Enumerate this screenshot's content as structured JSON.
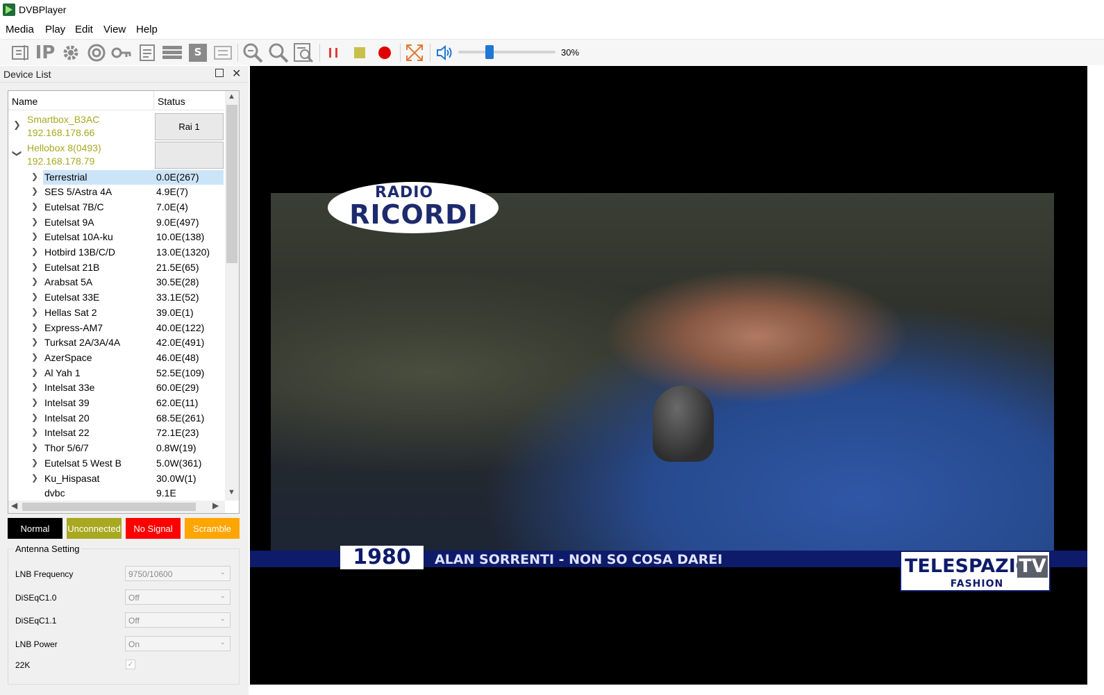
{
  "window": {
    "title": "DVBPlayer"
  },
  "menu": [
    "Media",
    "Play",
    "Edit",
    "View",
    "Help"
  ],
  "toolbar": {
    "icons": [
      "edit-icon",
      "ip-icon",
      "settings-gear-icon",
      "scan-icon",
      "key-icon",
      "notes-icon",
      "list-icon",
      "cam-icon",
      "led-icon",
      "zoom-in-icon",
      "search-icon",
      "report-icon",
      "pause-icon",
      "stop-icon",
      "record-icon",
      "fullscreen-icon",
      "volume-icon"
    ],
    "ip_label": "IP",
    "volume_percent": 30,
    "volume_label": "30%",
    "colors": {
      "pause": "#e23b3b",
      "stop": "#c9c04a",
      "record": "#e00000",
      "fullscreen": "#e07a32",
      "volume": "#1e78d4"
    }
  },
  "device_panel": {
    "title": "Device List",
    "columns": [
      "Name",
      "Status"
    ],
    "devices": [
      {
        "name": "Smartbox_B3AC",
        "ip": "192.168.178.66",
        "status": "Rai 1",
        "expanded": false
      },
      {
        "name": "Hellobox 8(0493)",
        "ip": "192.168.178.79",
        "status": "",
        "expanded": true
      }
    ],
    "satellites": [
      {
        "name": "Terrestrial",
        "value": "0.0E(267)",
        "selected": true
      },
      {
        "name": "SES 5/Astra 4A",
        "value": "4.9E(7)"
      },
      {
        "name": "Eutelsat 7B/C",
        "value": "7.0E(4)"
      },
      {
        "name": "Eutelsat 9A",
        "value": "9.0E(497)"
      },
      {
        "name": "Eutelsat 10A-ku",
        "value": "10.0E(138)"
      },
      {
        "name": "Hotbird 13B/C/D",
        "value": "13.0E(1320)"
      },
      {
        "name": "Eutelsat 21B",
        "value": "21.5E(65)"
      },
      {
        "name": "Arabsat 5A",
        "value": "30.5E(28)"
      },
      {
        "name": "Eutelsat 33E",
        "value": "33.1E(52)"
      },
      {
        "name": "Hellas Sat 2",
        "value": "39.0E(1)"
      },
      {
        "name": "Express-AM7",
        "value": "40.0E(122)"
      },
      {
        "name": "Turksat 2A/3A/4A",
        "value": "42.0E(491)"
      },
      {
        "name": "AzerSpace",
        "value": "46.0E(48)"
      },
      {
        "name": "Al Yah 1",
        "value": "52.5E(109)"
      },
      {
        "name": "Intelsat 33e",
        "value": "60.0E(29)"
      },
      {
        "name": "Intelsat 39",
        "value": "62.0E(11)"
      },
      {
        "name": "Intelsat 20",
        "value": "68.5E(261)"
      },
      {
        "name": "Intelsat 22",
        "value": "72.1E(23)"
      },
      {
        "name": "Thor 5/6/7",
        "value": "0.8W(19)"
      },
      {
        "name": "Eutelsat 5 West B",
        "value": "5.0W(361)"
      },
      {
        "name": "Ku_Hispasat",
        "value": "30.0W(1)"
      },
      {
        "name": "dvbc",
        "value": "9.1E",
        "no_chevron": true
      }
    ]
  },
  "legend": [
    {
      "label": "Normal",
      "bg": "#000000",
      "fg": "#ffffff"
    },
    {
      "label": "Unconnected",
      "bg": "#a8a821",
      "fg": "#ffffff"
    },
    {
      "label": "No Signal",
      "bg": "#ff0000",
      "fg": "#ffffff"
    },
    {
      "label": "Scramble",
      "bg": "#ffa500",
      "fg": "#ffffff"
    }
  ],
  "antenna": {
    "title": "Antenna Setting",
    "fields": [
      {
        "label": "LNB Frequency",
        "value": "9750/10600"
      },
      {
        "label": "DiSEqC1.0",
        "value": "Off"
      },
      {
        "label": "DiSEqC1.1",
        "value": "Off"
      },
      {
        "label": "LNB Power",
        "value": "On"
      }
    ],
    "checkbox": {
      "label": "22K",
      "checked": true
    }
  },
  "video": {
    "logo_top": "RADIO",
    "logo_main": "RICORDI",
    "ticker_year": "1980",
    "ticker_text": "ALAN SORRENTI - NON SO COSA DAREI",
    "channel_logo": "TELESPAZIO",
    "channel_logo_suffix": "TV",
    "channel_logo_sub": "FASHION"
  }
}
